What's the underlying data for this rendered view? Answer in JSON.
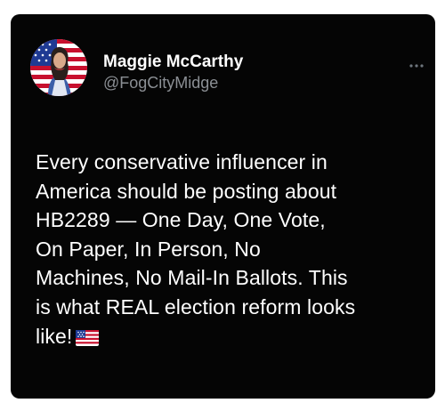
{
  "tweet": {
    "author": {
      "display_name": "Maggie McCarthy",
      "handle": "@FogCityMidge",
      "avatar_icon": "profile-photo-with-american-flag"
    },
    "more_icon": "more-options-icon",
    "lines": [
      "Every conservative influencer in",
      "America should be posting about",
      "HB2289 — One Day, One Vote,",
      "On Paper, In Person, No",
      "Machines, No Mail-In Ballots. This",
      "is what REAL election reform looks",
      "like!"
    ],
    "trailing_emoji": "us-flag-emoji"
  },
  "colors": {
    "card_background": "#050505",
    "primary_text": "#ffffff",
    "secondary_text": "#8b8f94"
  }
}
